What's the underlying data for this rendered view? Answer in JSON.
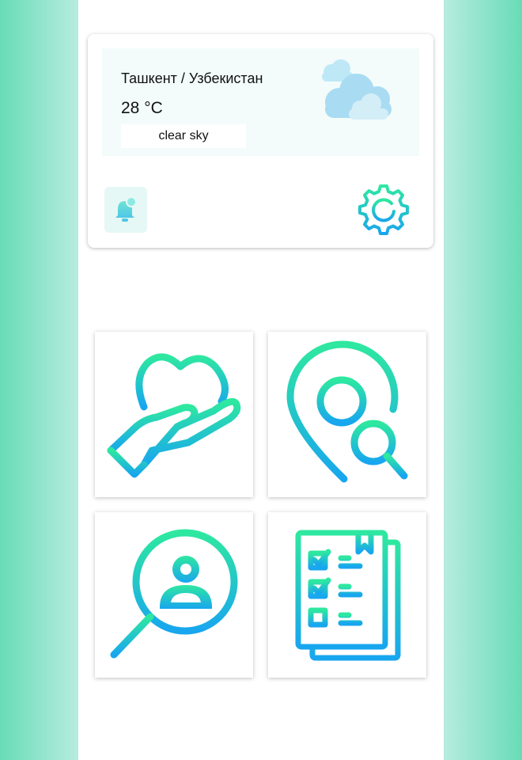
{
  "weather": {
    "location": "Ташкент / Узбекистан",
    "temperature": "28 °C",
    "description": "clear sky",
    "icon": "clouds-icon"
  },
  "actions": {
    "notifications_icon": "bell-icon",
    "settings_icon": "gear-icon"
  },
  "tiles": [
    {
      "icon": "heart-in-hand-icon"
    },
    {
      "icon": "location-search-icon"
    },
    {
      "icon": "user-search-icon"
    },
    {
      "icon": "checklist-icon"
    }
  ],
  "colors": {
    "gradient_start": "#2ee8a0",
    "gradient_end": "#18a6ef",
    "panel_background": "#f3fcfa",
    "side_background": "#68dcb6"
  }
}
